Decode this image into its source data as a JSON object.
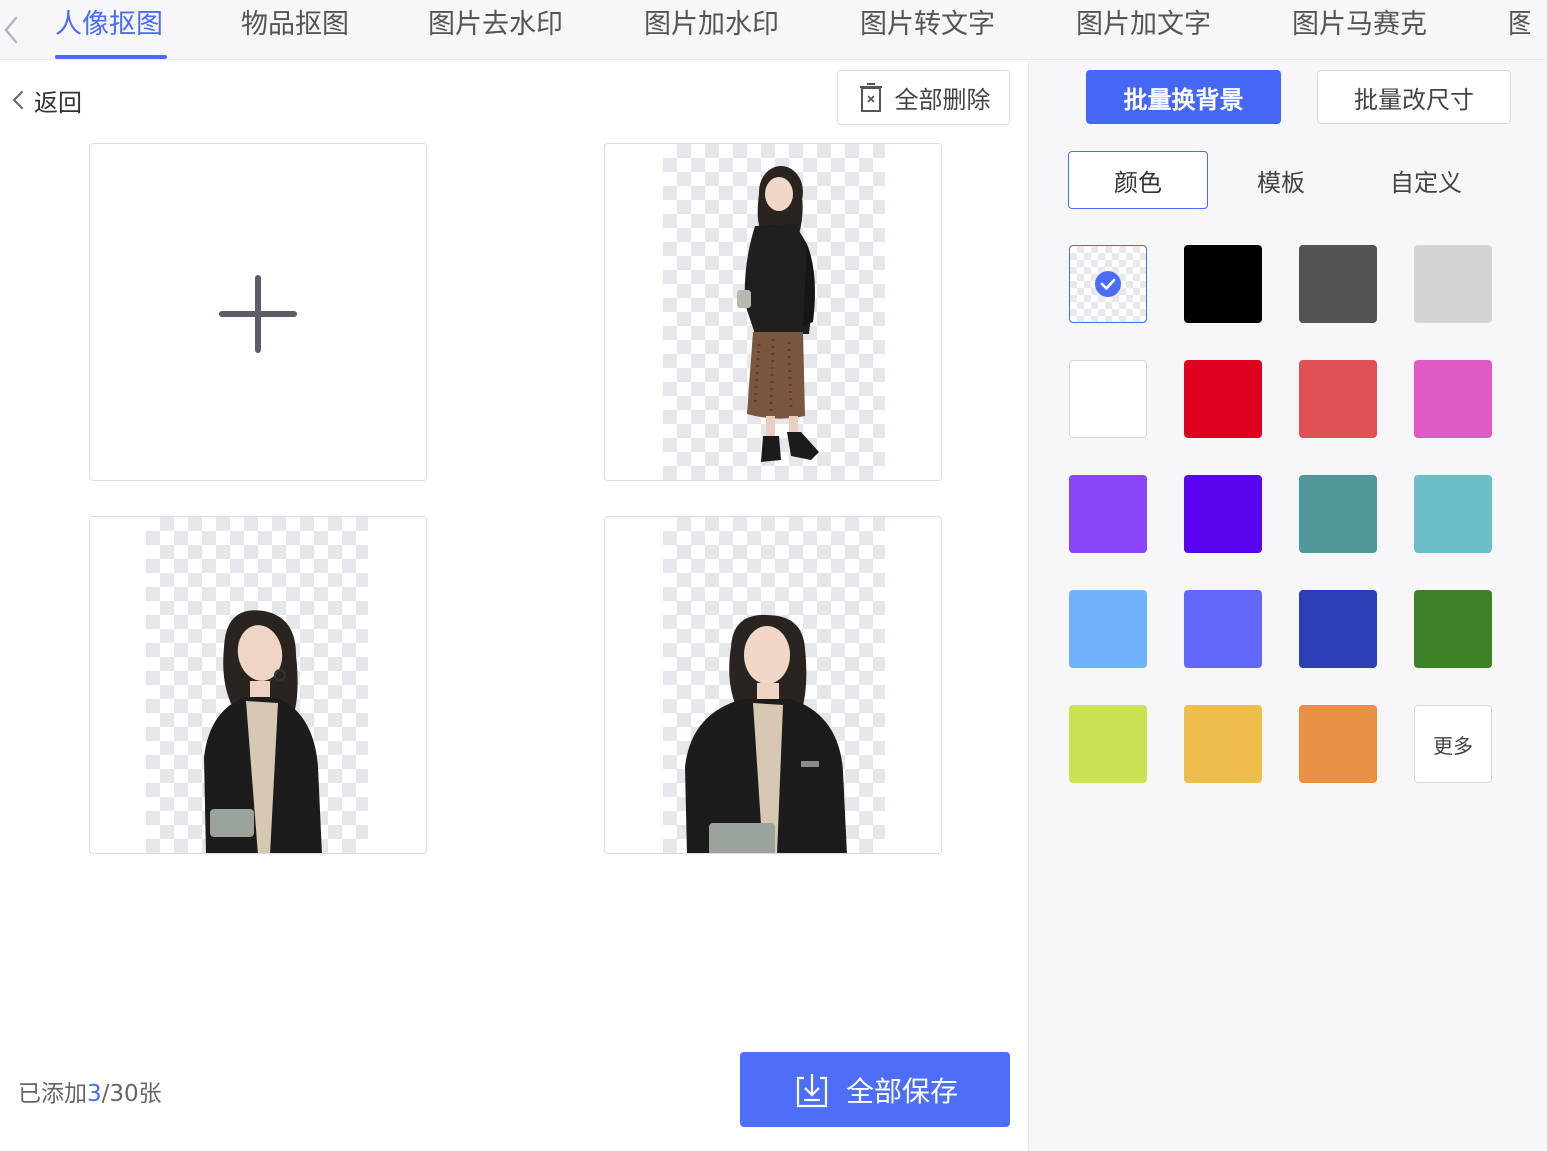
{
  "tabs": [
    {
      "label": "人像抠图",
      "active": true
    },
    {
      "label": "物品抠图",
      "active": false
    },
    {
      "label": "图片去水印",
      "active": false
    },
    {
      "label": "图片加水印",
      "active": false
    },
    {
      "label": "图片转文字",
      "active": false
    },
    {
      "label": "图片加文字",
      "active": false
    },
    {
      "label": "图片马赛克",
      "active": false
    },
    {
      "label": "图",
      "active": false
    }
  ],
  "toolbar": {
    "back_label": "返回",
    "delete_all_label": "全部删除"
  },
  "status": {
    "prefix": "已添加",
    "added": "3",
    "suffix": "/30张"
  },
  "save_all_label": "全部保存",
  "panel": {
    "mode_buttons": {
      "batch_background": "批量换背景",
      "batch_resize": "批量改尺寸"
    },
    "subtabs": [
      "颜色",
      "模板",
      "自定义"
    ],
    "active_subtab": "颜色",
    "swatches": [
      {
        "name": "transparent",
        "color": "transparent",
        "selected": true
      },
      {
        "name": "black",
        "color": "#000000"
      },
      {
        "name": "dark-gray",
        "color": "#535353"
      },
      {
        "name": "light-gray",
        "color": "#d3d3d3"
      },
      {
        "name": "white",
        "color": "#ffffff"
      },
      {
        "name": "red",
        "color": "#df001f"
      },
      {
        "name": "coral",
        "color": "#e05156"
      },
      {
        "name": "magenta",
        "color": "#e05ac6"
      },
      {
        "name": "violet",
        "color": "#8a44fa"
      },
      {
        "name": "indigo",
        "color": "#5a04ef"
      },
      {
        "name": "teal",
        "color": "#52989b"
      },
      {
        "name": "cyan",
        "color": "#6cbfc9"
      },
      {
        "name": "sky-blue",
        "color": "#70b2fb"
      },
      {
        "name": "periwinkle",
        "color": "#6168f9"
      },
      {
        "name": "royal-blue",
        "color": "#2c3fb5"
      },
      {
        "name": "green",
        "color": "#3d8127"
      },
      {
        "name": "lime",
        "color": "#cde253"
      },
      {
        "name": "yellow",
        "color": "#efbd4c"
      },
      {
        "name": "orange",
        "color": "#e89044"
      }
    ],
    "more_label": "更多"
  },
  "images": [
    {
      "name": "portrait-full-body"
    },
    {
      "name": "portrait-half-body-tilted"
    },
    {
      "name": "portrait-half-body-front"
    }
  ],
  "colors": {
    "accent": "#4a6cf7",
    "primary_button": "#4467f5"
  }
}
